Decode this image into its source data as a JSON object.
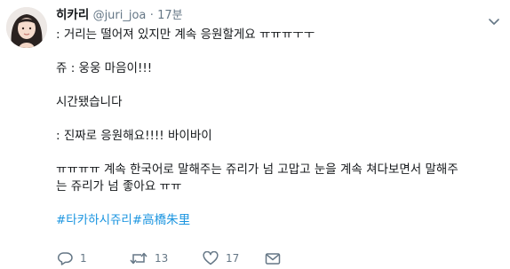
{
  "tweet": {
    "display_name": "히카리",
    "handle": "@juri_joa",
    "separator": "·",
    "time": "17분",
    "lines": [
      ": 거리는 떨어져 있지만 계속 응원할게요 ㅠㅠㅠㅜㅜ",
      "쥬 : 웅웅 마음이!!!",
      "시간됐습니다",
      ": 진짜로 응원해요!!!! 바이바이",
      "ㅠㅠㅠㅠ 계속 한국어로 말해주는 쥬리가 넘 고맙고 눈을 계속 쳐다보면서 말해주",
      "는 쥬리가 넘 좋아요 ㅠㅠ"
    ],
    "hashtags": [
      "#타카하시쥬리",
      "#高橋朱里"
    ],
    "stats": {
      "replies": "1",
      "retweets": "13",
      "likes": "17"
    }
  },
  "colors": {
    "link": "#1b95e0",
    "secondary_text": "#657786",
    "primary_text": "#14171a"
  },
  "icons": [
    "avatar",
    "caret-down-icon",
    "reply-icon",
    "retweet-icon",
    "like-icon",
    "direct-message-icon"
  ]
}
